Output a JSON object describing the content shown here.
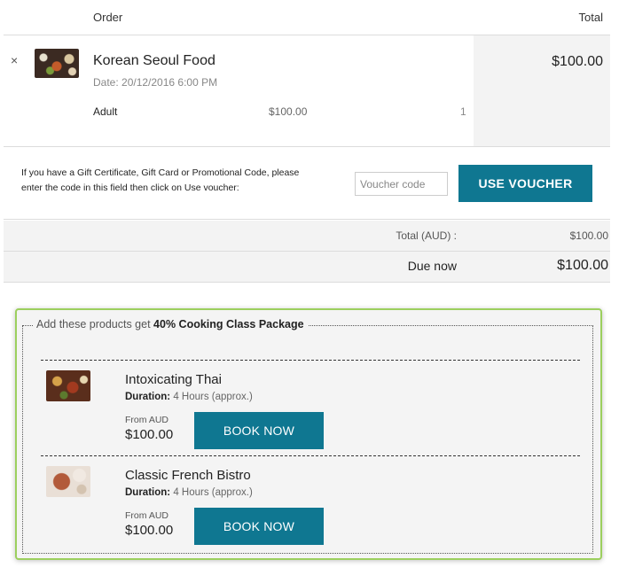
{
  "cart": {
    "headers": {
      "order": "Order",
      "total": "Total"
    },
    "item": {
      "remove": "×",
      "title": "Korean Seoul Food",
      "date": "Date: 20/12/2016 6:00 PM",
      "ticket_type": "Adult",
      "unit_price": "$100.00",
      "quantity": "1",
      "line_total": "$100.00",
      "thumbnail_icon": "food-photo"
    }
  },
  "voucher": {
    "instructions": "If you have a Gift Certificate, Gift Card or Promotional Code, please enter the code in this field then click on Use voucher:",
    "input_placeholder": "Voucher code",
    "input_value": "",
    "button_label": "USE VOUCHER"
  },
  "summary": {
    "total_label": "Total (AUD) :",
    "total_value": "$100.00",
    "due_label": "Due now",
    "due_value": "$100.00"
  },
  "promo": {
    "legend_prefix": "Add these products get",
    "legend_bold": "40% Cooking Class Package",
    "products": [
      {
        "name": "Intoxicating Thai",
        "duration_label": "Duration:",
        "duration_value": "4 Hours (approx.)",
        "from_label": "From AUD",
        "price": "$100.00",
        "button_label": "BOOK NOW"
      },
      {
        "name": "Classic French Bistro",
        "duration_label": "Duration:",
        "duration_value": "4 Hours (approx.)",
        "from_label": "From AUD",
        "price": "$100.00",
        "button_label": "BOOK NOW"
      }
    ]
  },
  "colors": {
    "accent_button": "#0f7791",
    "promo_border": "#9ccf5e",
    "panel_bg": "#f3f3f3"
  }
}
